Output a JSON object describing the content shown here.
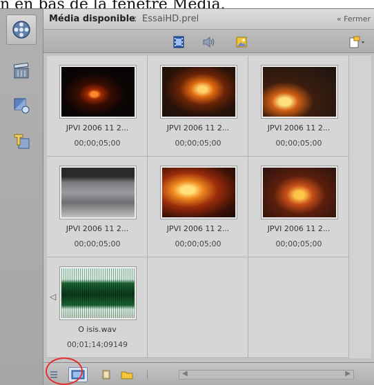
{
  "caption": {
    "text": "n en bas de la fenêtre Média."
  },
  "panel": {
    "title_label": "Média disponible",
    "title_sep": ":",
    "title_file": "EssaiHD.prel",
    "close_label": "« Fermer"
  },
  "toolbar": {
    "icons": [
      "film-icon",
      "speaker-icon",
      "image-icon",
      "new-item-icon"
    ]
  },
  "sidebar": {
    "icons": [
      "film-reel-icon",
      "folder-clapper-icon",
      "effects-icon",
      "title-icon"
    ]
  },
  "media": [
    {
      "name": "JPVI 2006 11 2...",
      "duration": "00;00;05;00"
    },
    {
      "name": "JPVI 2006 11 2...",
      "duration": "00;00;05;00"
    },
    {
      "name": "JPVI 2006 11 2...",
      "duration": "00;00;05;00"
    },
    {
      "name": "JPVI 2006 11 2...",
      "duration": "00;00;05;00"
    },
    {
      "name": "JPVI 2006 11 2...",
      "duration": "00;00;05;00"
    },
    {
      "name": "JPVI 2006 11 2...",
      "duration": "00;00;05;00"
    },
    {
      "name": "O isis.wav",
      "duration": "00;01;14;09149"
    }
  ],
  "statusbar": {
    "icons": [
      "list-view-icon",
      "icon-view-icon",
      "film-small-icon",
      "folder-icon",
      "divider-icon"
    ]
  },
  "colors": {
    "highlight": "#e0302a",
    "panel_bg": "#c4c4c4"
  }
}
